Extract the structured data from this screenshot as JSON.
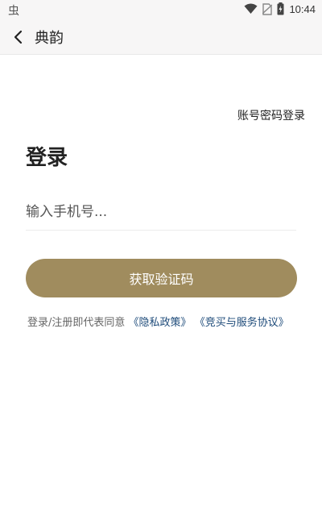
{
  "status_bar": {
    "left_icon": "bug-icon",
    "left_glyph": "虫",
    "time": "10:44",
    "icons": [
      "wifi-icon",
      "no-sim-icon",
      "battery-charging-icon"
    ]
  },
  "nav": {
    "back_icon": "chevron-left-icon",
    "title": "典韵"
  },
  "main": {
    "account_login_link": "账号密码登录",
    "title": "登录",
    "phone_placeholder": "输入手机号...",
    "phone_value": "",
    "get_code_button": "获取验证码",
    "agreement_prefix": "登录/注册即代表同意",
    "privacy_link": "《隐私政策》",
    "service_link": "《竞买与服务协议》"
  },
  "colors": {
    "accent": "#a08c5e",
    "link": "#1e4b7a",
    "bar_background": "#f7f6f6"
  }
}
